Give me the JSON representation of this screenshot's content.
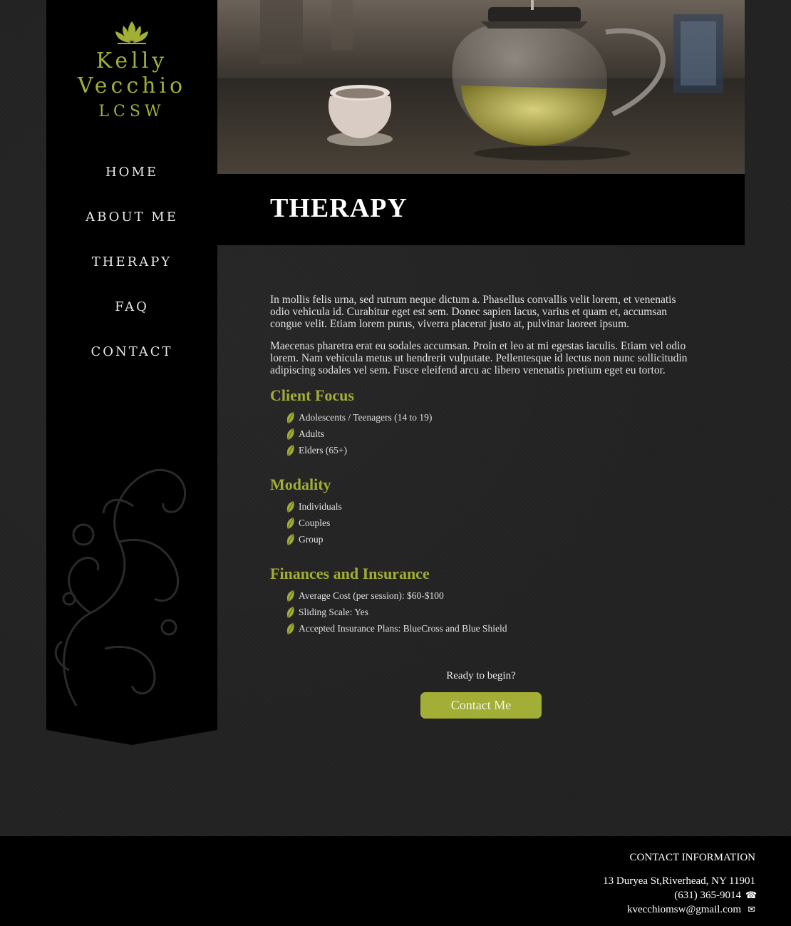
{
  "brand": {
    "first": "Kelly",
    "last": "Vecchio",
    "credential": "LCSW",
    "accent_color": "#a2ae36"
  },
  "nav": {
    "items": [
      {
        "label": "HOME"
      },
      {
        "label": "ABOUT ME"
      },
      {
        "label": "THERAPY"
      },
      {
        "label": "FAQ"
      },
      {
        "label": "CONTACT"
      }
    ]
  },
  "hero": {
    "image": "teapot-and-teacup-photo"
  },
  "page": {
    "title": "THERAPY",
    "paragraphs": [
      "In mollis felis urna, sed rutrum neque dictum a. Phasellus convallis velit lorem, et venenatis odio vehicula id. Curabitur eget est sem. Donec sapien lacus, varius et quam et, accumsan congue velit. Etiam lorem purus, viverra placerat justo at, pulvinar laoreet ipsum.",
      "Maecenas pharetra erat eu sodales accumsan. Proin et leo at mi egestas iaculis. Etiam vel odio lorem. Nam vehicula metus ut hendrerit vulputate. Pellentesque id lectus non nunc sollicitudin adipiscing sodales vel sem. Fusce eleifend arcu ac libero venenatis pretium eget eu tortor."
    ],
    "sections": [
      {
        "title": "Client Focus",
        "items": [
          "Adolescents / Teenagers (14 to 19)",
          "Adults",
          "Elders (65+)"
        ]
      },
      {
        "title": "Modality",
        "items": [
          "Individuals",
          "Couples",
          "Group"
        ]
      },
      {
        "title": "Finances and Insurance",
        "items": [
          "Average Cost (per session): $60-$100",
          "Sliding Scale: Yes",
          "Accepted Insurance Plans: BlueCross and Blue Shield"
        ]
      }
    ],
    "cta": {
      "prompt": "Ready to begin?",
      "button_label": "Contact Me"
    }
  },
  "footer": {
    "heading": "CONTACT INFORMATION",
    "address": "13 Duryea St,Riverhead, NY 11901",
    "phone": "(631) 365-9014",
    "email": "kvecchiomsw@gmail.com",
    "phone_icon": "phone-icon",
    "email_icon": "envelope-icon"
  }
}
